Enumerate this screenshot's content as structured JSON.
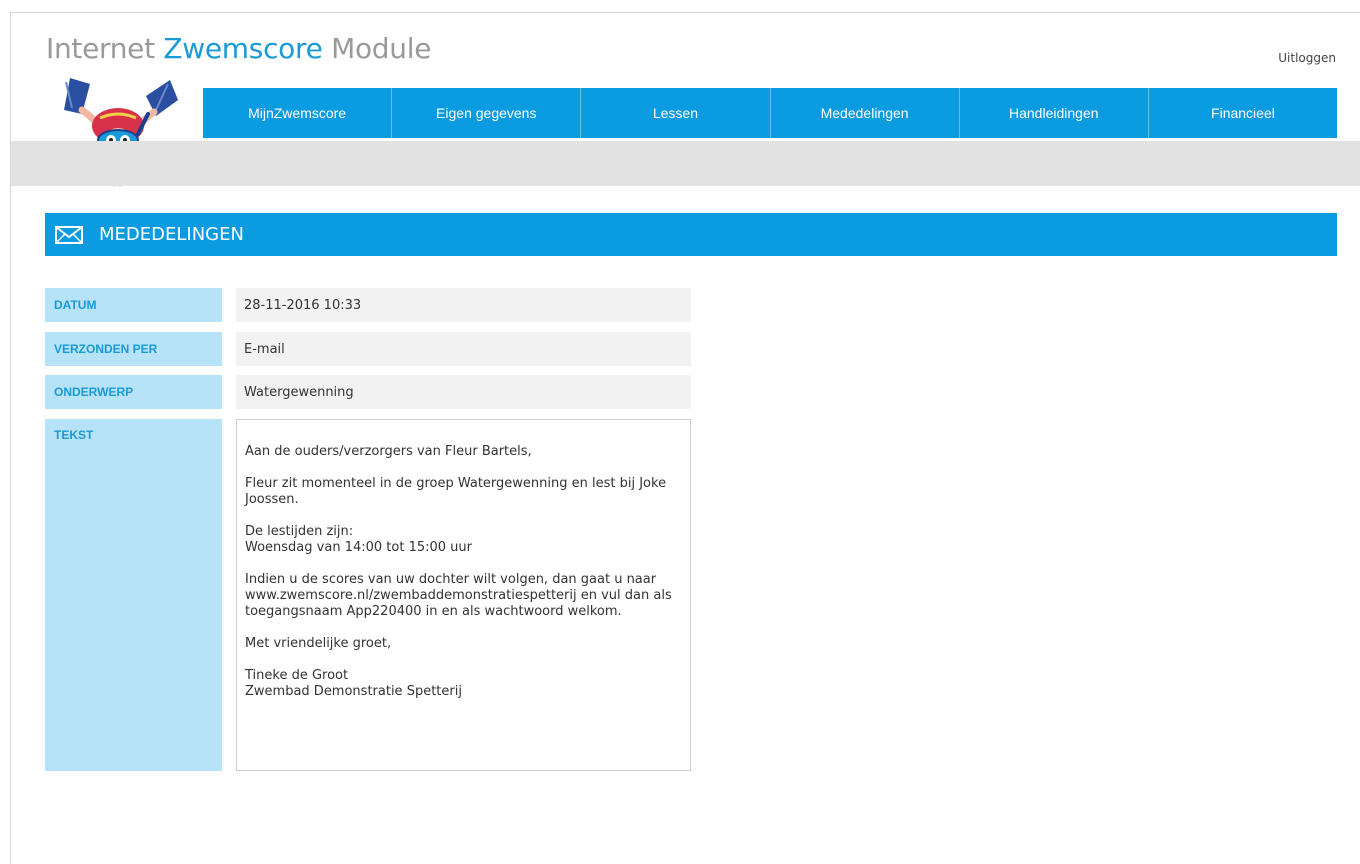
{
  "header": {
    "title_part1": "Internet ",
    "title_accent": "Zwemscore",
    "title_part2": " Module",
    "logout_label": "Uitloggen",
    "mascot_icon": "swimmer-mascot-icon"
  },
  "nav": {
    "items": [
      {
        "label": "MijnZwemscore"
      },
      {
        "label": "Eigen gegevens"
      },
      {
        "label": "Lessen"
      },
      {
        "label": "Mededelingen"
      },
      {
        "label": "Handleidingen"
      },
      {
        "label": "Financieel"
      }
    ]
  },
  "section": {
    "icon": "envelope-icon",
    "title": "MEDEDELINGEN"
  },
  "message": {
    "datum_label": "DATUM",
    "datum_value": "28-11-2016 10:33",
    "verzonden_label": "VERZONDEN PER",
    "verzonden_value": "E-mail",
    "onderwerp_label": "ONDERWERP",
    "onderwerp_value": "Watergewenning",
    "tekst_label": "TEKST",
    "tekst": {
      "greeting": "Aan de ouders/verzorgers van Fleur Bartels,",
      "para1": "Fleur zit momenteel in de groep Watergewenning en lest bij Joke Joossen.",
      "times_title": "De lestijden zijn:",
      "times_value": "Woensdag van 14:00 tot 15:00 uur",
      "para3": "Indien u de scores van uw dochter wilt volgen, dan gaat u naar www.zwemscore.nl/zwembaddemonstratiespetterij en vul dan als toegangsnaam App220400 in en als wachtwoord welkom.",
      "closing": "Met vriendelijke groet,",
      "sender_name": "Tineke de Groot",
      "sender_org": "Zwembad Demonstratie Spetterij"
    }
  },
  "colors": {
    "accent": "#0a9be0",
    "label_bg": "#b7e3f8",
    "value_bg": "#f2f2f2"
  }
}
